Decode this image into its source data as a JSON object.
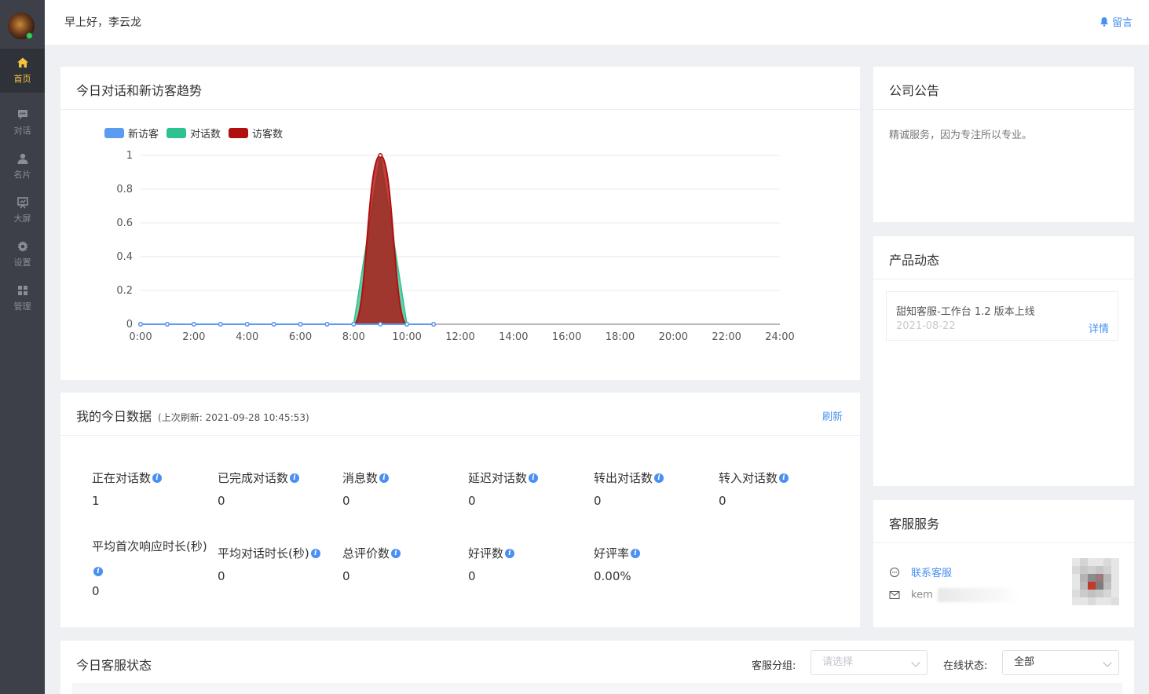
{
  "sidebar": {
    "items": [
      {
        "label": "首页",
        "icon": "home-icon"
      },
      {
        "label": "对话",
        "icon": "chat-icon"
      },
      {
        "label": "名片",
        "icon": "user-card-icon"
      },
      {
        "label": "大屏",
        "icon": "screen-icon"
      },
      {
        "label": "设置",
        "icon": "gear-icon"
      },
      {
        "label": "管理",
        "icon": "grid-icon"
      }
    ]
  },
  "header": {
    "greeting": "早上好，李云龙",
    "message_label": "留言"
  },
  "trend": {
    "title": "今日对话和新访客趋势",
    "chart_data": {
      "type": "area",
      "x": [
        "0:00",
        "1:00",
        "2:00",
        "3:00",
        "4:00",
        "5:00",
        "6:00",
        "7:00",
        "8:00",
        "9:00",
        "10:00",
        "11:00"
      ],
      "x_ticks": [
        "0:00",
        "2:00",
        "4:00",
        "6:00",
        "8:00",
        "10:00",
        "12:00",
        "14:00",
        "16:00",
        "18:00",
        "20:00",
        "22:00",
        "24:00"
      ],
      "y_ticks": [
        "1",
        "0.8",
        "0.6",
        "0.4",
        "0.2",
        "0"
      ],
      "ylim": [
        0,
        1
      ],
      "xlim": [
        0,
        24
      ],
      "series": [
        {
          "name": "新访客",
          "color": "#5b9cf2",
          "values": [
            0,
            0,
            0,
            0,
            0,
            0,
            0,
            0,
            0,
            0,
            0,
            0
          ]
        },
        {
          "name": "对话数",
          "color": "#2ec28f",
          "values": [
            0,
            0,
            0,
            0,
            0,
            0,
            0,
            0,
            0,
            1,
            0,
            0
          ]
        },
        {
          "name": "访客数",
          "color": "#b0100f",
          "values": [
            0,
            0,
            0,
            0,
            0,
            0,
            0,
            0,
            0,
            1,
            0,
            0
          ]
        }
      ],
      "grid": true,
      "legend": "top-left"
    }
  },
  "today": {
    "title": "我的今日数据",
    "refresh_time": "(上次刷新: 2021-09-28 10:45:53)",
    "refresh_label": "刷新",
    "stats": [
      {
        "label": "正在对话数",
        "value": "1"
      },
      {
        "label": "已完成对话数",
        "value": "0"
      },
      {
        "label": "消息数",
        "value": "0"
      },
      {
        "label": "延迟对话数",
        "value": "0"
      },
      {
        "label": "转出对话数",
        "value": "0"
      },
      {
        "label": "转入对话数",
        "value": "0"
      },
      {
        "label": "平均首次响应时长(秒)",
        "value": "0"
      },
      {
        "label": "平均对话时长(秒)",
        "value": "0"
      },
      {
        "label": "总评价数",
        "value": "0"
      },
      {
        "label": "好评数",
        "value": "0"
      },
      {
        "label": "好评率",
        "value": "0.00%"
      }
    ]
  },
  "notice": {
    "title": "公司公告",
    "text": "精诚服务，因为专注所以专业。"
  },
  "product": {
    "title": "产品动态",
    "item_title": "甜知客服-工作台 1.2 版本上线",
    "item_date": "2021-08-22",
    "item_detail": "详情"
  },
  "service": {
    "title": "客服服务",
    "contact_label": "联系客服",
    "email_partial": "kem"
  },
  "status": {
    "title": "今日客服状态",
    "group_label": "客服分组:",
    "group_placeholder": "请选择",
    "online_label": "在线状态:",
    "online_value": "全部"
  },
  "colors": {
    "accent": "#4a8ff2",
    "sidebar_bg": "#3d4048",
    "active_nav": "#f5c33b"
  }
}
